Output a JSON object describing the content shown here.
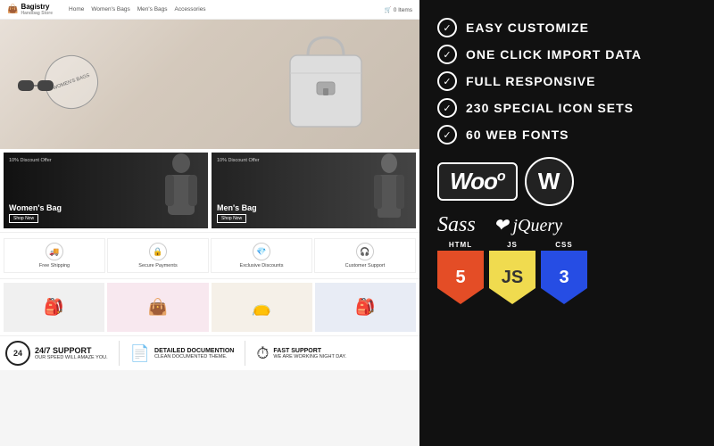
{
  "left": {
    "header": {
      "logo_text": "Bagistry",
      "logo_sub": "Handbag Store",
      "nav_items": [
        "Home",
        "Women's Bags",
        "Men's Bags",
        "Accessories"
      ],
      "cart_text": "0 Items"
    },
    "hero": {
      "badge_text": "WOMEN'S BAGS"
    },
    "promos": [
      {
        "discount": "10% Discount Offer",
        "title": "Women's Bag",
        "btn": "Shop Now"
      },
      {
        "discount": "10% Discount Offer",
        "title": "Men's Bag",
        "btn": "Shop Now"
      }
    ],
    "features": [
      {
        "icon": "🚚",
        "label": "Free Shipping"
      },
      {
        "icon": "🔒",
        "label": "Secure Payments"
      },
      {
        "icon": "💎",
        "label": "Exclusive Discounts"
      },
      {
        "icon": "🎧",
        "label": "Customer Support"
      }
    ],
    "bottom": {
      "support_24_7": {
        "number": "24",
        "title": "24/7 SUPPORT",
        "subtitle": "OUR SPEED WILL AMAZE YOU."
      },
      "doc": {
        "title": "DETAILED DOCUMENTION",
        "subtitle": "CLEAN DOCUMENTED THEME."
      },
      "fast": {
        "title": "FAST SUPPORT",
        "subtitle": "WE ARE WORKING NIGHT DAY."
      }
    }
  },
  "right": {
    "features": [
      {
        "label": "EASY CUSTOMIZE"
      },
      {
        "label": "ONE CLICK IMPORT DATA"
      },
      {
        "label": "FULL RESPONSIVE"
      },
      {
        "label": "230 SPECIAL ICON SETS"
      },
      {
        "label": "60 WEB FONTS"
      }
    ],
    "tech": {
      "woo": "Woo",
      "wp": "W",
      "sass": "Sass",
      "jquery": "jQuery",
      "badges": [
        {
          "label": "HTML",
          "number": "5"
        },
        {
          "label": "JS",
          "number": "JS"
        },
        {
          "label": "CSS",
          "number": "3"
        }
      ]
    }
  }
}
